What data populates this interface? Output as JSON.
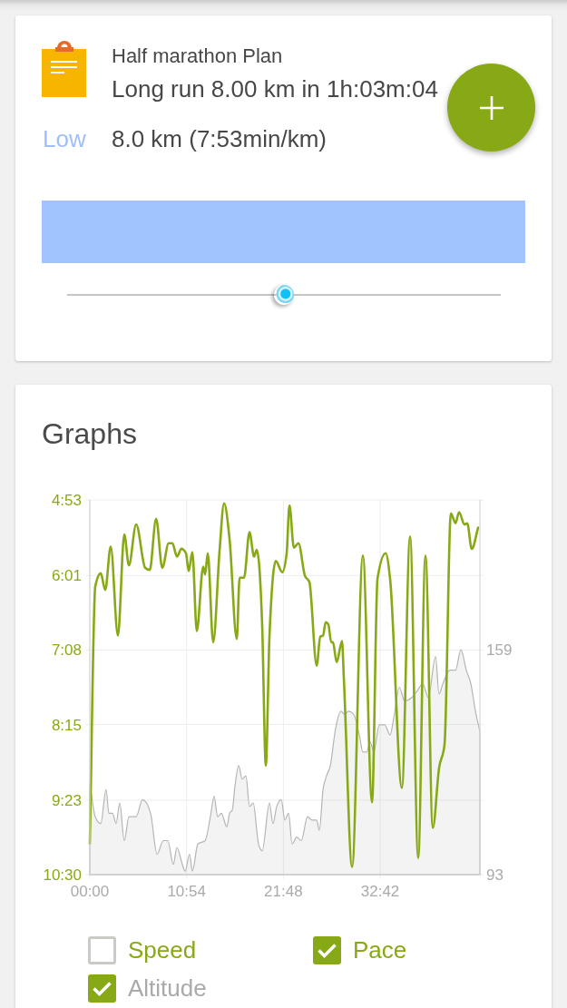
{
  "plan": {
    "title": "Half marathon Plan",
    "workout": "Long run 8.00 km in 1h:03m:04",
    "intensity": "Low",
    "summary": "8.0 km (7:53min/km)",
    "slider": {
      "level": 0.5
    }
  },
  "graphs": {
    "title": "Graphs",
    "chart_data": {
      "type": "line",
      "grid": true,
      "xlim": [
        0,
        2636
      ],
      "xticks": [
        {
          "value": 0,
          "label": "00:00"
        },
        {
          "value": 654,
          "label": "10:54"
        },
        {
          "value": 1308,
          "label": "21:48"
        },
        {
          "value": 1962,
          "label": "32:42"
        }
      ],
      "ylim": [
        630,
        293
      ],
      "yticks": [
        {
          "value": 293,
          "label": "4:53"
        },
        {
          "value": 361,
          "label": "6:01"
        },
        {
          "value": 428,
          "label": "7:08"
        },
        {
          "value": 495,
          "label": "8:15"
        },
        {
          "value": 563,
          "label": "9:23"
        },
        {
          "value": 630,
          "label": "10:30"
        }
      ],
      "y2lim": [
        93,
        203
      ],
      "y2ticks": [
        {
          "value": 93,
          "label": "93"
        },
        {
          "value": 159,
          "label": "159"
        }
      ],
      "series": [
        {
          "type": "area",
          "axis": "y2",
          "color": "#b5b5b5",
          "x": [
            0,
            37,
            74,
            110,
            129,
            153,
            178,
            202,
            233,
            264,
            313,
            356,
            411,
            454,
            497,
            527,
            564,
            589,
            625,
            644,
            674,
            693,
            730,
            779,
            815,
            840,
            864,
            889,
            926,
            944,
            963,
            981,
            1006,
            1030,
            1055,
            1079,
            1104,
            1140,
            1165,
            1214,
            1238,
            1263,
            1294,
            1318,
            1343,
            1367,
            1398,
            1429,
            1471,
            1502,
            1533,
            1551,
            1576,
            1600,
            1625,
            1661,
            1698,
            1723,
            1747,
            1784,
            1821,
            1845,
            1870,
            1894,
            1919,
            1956,
            1993,
            2029,
            2054,
            2091,
            2127,
            2176,
            2213,
            2250,
            2287,
            2336,
            2360,
            2385,
            2434,
            2471,
            2508,
            2544,
            2575,
            2606,
            2636
          ],
          "values": [
            120,
            110,
            108,
            118,
            111,
            111,
            108,
            114,
            103,
            110,
            110,
            115,
            111,
            99,
            103,
            103,
            96,
            101,
            96,
            94,
            99,
            94,
            102,
            103,
            110,
            116,
            110,
            111,
            107,
            111,
            112,
            119,
            125,
            121,
            122,
            113,
            114,
            102,
            100,
            114,
            108,
            113,
            115,
            109,
            111,
            102,
            104,
            103,
            110,
            109,
            109,
            106,
            118,
            122,
            125,
            136,
            141,
            140,
            141,
            140,
            134,
            129,
            129,
            132,
            129,
            137,
            137,
            134,
            139,
            148,
            144,
            145,
            147,
            149,
            145,
            157,
            146,
            149,
            153,
            153,
            159,
            153,
            149,
            141,
            135
          ]
        },
        {
          "type": "line",
          "color": "#88a916",
          "x": [
            0,
            37,
            74,
            104,
            141,
            190,
            233,
            264,
            313,
            374,
            405,
            448,
            490,
            533,
            558,
            589,
            619,
            650,
            668,
            693,
            723,
            766,
            779,
            797,
            834,
            877,
            907,
            944,
            993,
            1012,
            1042,
            1079,
            1110,
            1128,
            1165,
            1189,
            1214,
            1257,
            1300,
            1330,
            1349,
            1379,
            1410,
            1453,
            1484,
            1533,
            1557,
            1576,
            1594,
            1612,
            1631,
            1643,
            1668,
            1704,
            1717,
            1772,
            1845,
            1907,
            1944,
            1999,
            2029,
            2109,
            2164,
            2219,
            2268,
            2318,
            2360,
            2397,
            2440,
            2471,
            2495,
            2532,
            2550,
            2581,
            2624
          ],
          "values": [
            602,
            371,
            359,
            374,
            335,
            415,
            324,
            352,
            315,
            354,
            356,
            310,
            354,
            332,
            332,
            344,
            337,
            341,
            357,
            340,
            411,
            353,
            360,
            341,
            421,
            338,
            296,
            328,
            418,
            363,
            363,
            322,
            344,
            338,
            406,
            532,
            416,
            348,
            358,
            341,
            298,
            336,
            332,
            361,
            367,
            442,
            416,
            415,
            403,
            405,
            421,
            421,
            439,
            420,
            455,
            623,
            343,
            565,
            364,
            341,
            364,
            552,
            326,
            615,
            343,
            588,
            534,
            513,
            305,
            314,
            304,
            315,
            314,
            337,
            318
          ]
        }
      ]
    },
    "legend": [
      {
        "label": "Speed",
        "checked": false,
        "color": "#88a916"
      },
      {
        "label": "Pace",
        "checked": true,
        "color": "#88a916"
      },
      {
        "label": "Altitude",
        "checked": true,
        "color": "#aaaaaa"
      }
    ]
  }
}
